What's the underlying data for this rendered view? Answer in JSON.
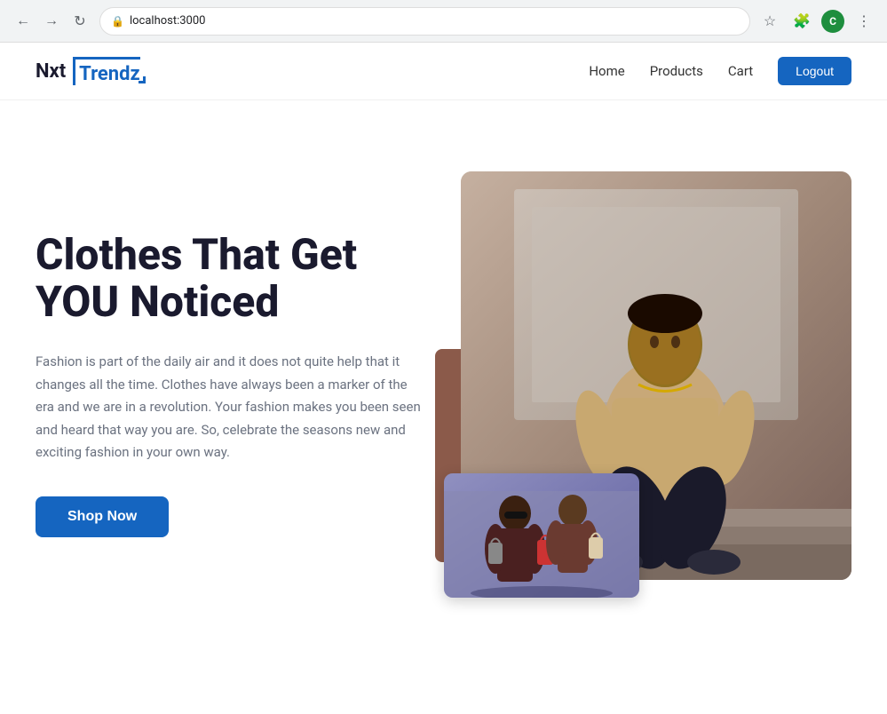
{
  "browser": {
    "url": "localhost:3000",
    "back_label": "←",
    "forward_label": "→",
    "refresh_label": "↻",
    "profile_initial": "C"
  },
  "navbar": {
    "logo_nxt": "Nxt",
    "logo_trendz": "Trendz",
    "nav_home": "Home",
    "nav_products": "Products",
    "nav_cart": "Cart",
    "logout_label": "Logout"
  },
  "hero": {
    "title": "Clothes That Get YOU Noticed",
    "description": "Fashion is part of the daily air and it does not quite help that it changes all the time. Clothes have always been a marker of the era and we are in a revolution. Your fashion makes you been seen and heard that way you are. So, celebrate the seasons new and exciting fashion in your own way.",
    "shop_now_label": "Shop Now"
  }
}
